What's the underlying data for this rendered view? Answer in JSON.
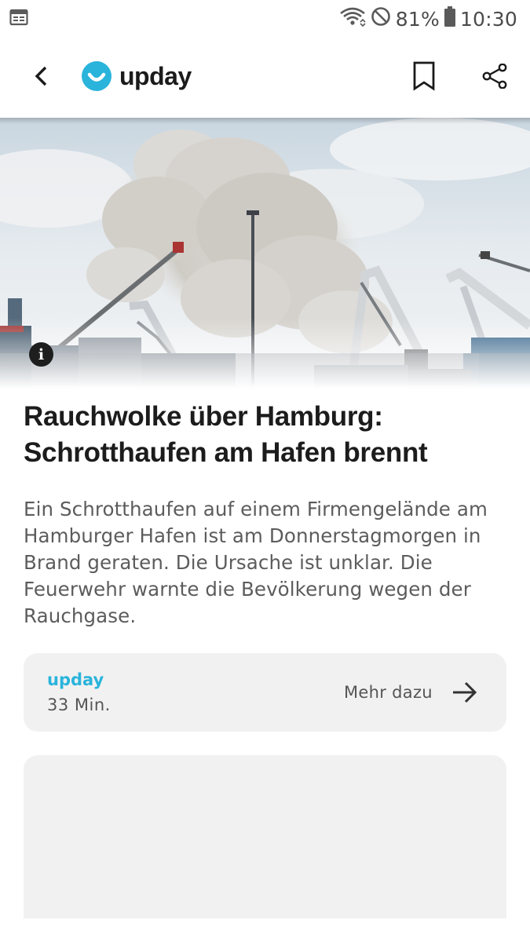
{
  "status_bar": {
    "battery": "81%",
    "time": "10:30",
    "icons": [
      "calendar-icon",
      "wifi-icon",
      "do-not-disturb-icon",
      "battery-icon"
    ]
  },
  "app_bar": {
    "logo_text": "upday",
    "icons": [
      "back-arrow-icon",
      "bookmark-icon",
      "share-icon"
    ],
    "brand_color": "#2ab4db"
  },
  "article": {
    "headline": "Rauchwolke über Hamburg: Schrotthaufen am Hafen brennt",
    "summary": "Ein Schrotthaufen auf einem Firmengelände am Hamburger Hafen ist am Donnerstagmorgen in Brand geraten. Die Ursache ist unklar. Die Feuerwehr warnte die Bevölkerung wegen der Rauchgase.",
    "image_info_label": "i"
  },
  "source_card": {
    "source": "upday",
    "time_ago": "33 Min.",
    "more_label": "Mehr dazu"
  }
}
